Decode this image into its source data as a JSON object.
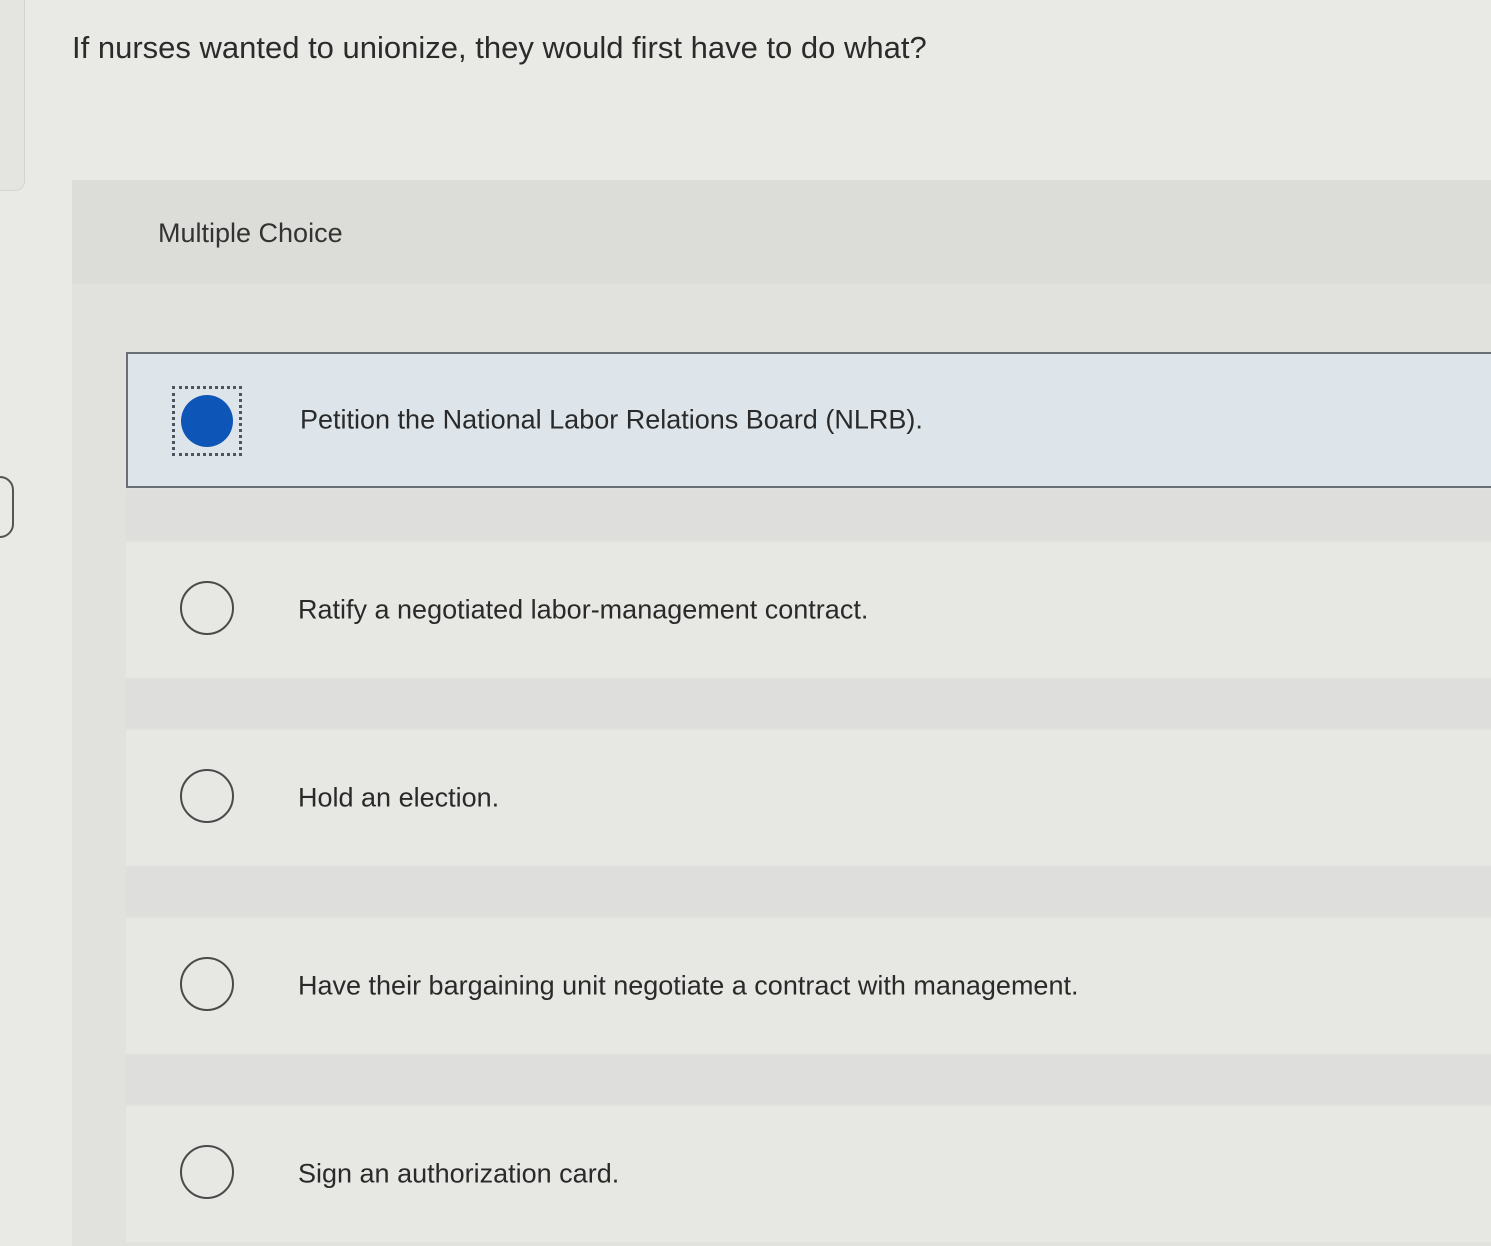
{
  "question": {
    "text": "If nurses wanted to unionize, they would first have to do what?"
  },
  "panel": {
    "label": "Multiple Choice"
  },
  "options": [
    {
      "label": "Petition the National Labor Relations Board (NLRB).",
      "selected": true
    },
    {
      "label": "Ratify a negotiated labor-management contract.",
      "selected": false
    },
    {
      "label": "Hold an election.",
      "selected": false
    },
    {
      "label": "Have their bargaining unit negotiate a contract with management.",
      "selected": false
    },
    {
      "label": "Sign an authorization card.",
      "selected": false
    }
  ],
  "colors": {
    "selected_radio": "#0d56b8",
    "selected_background": "#dde5ea"
  }
}
